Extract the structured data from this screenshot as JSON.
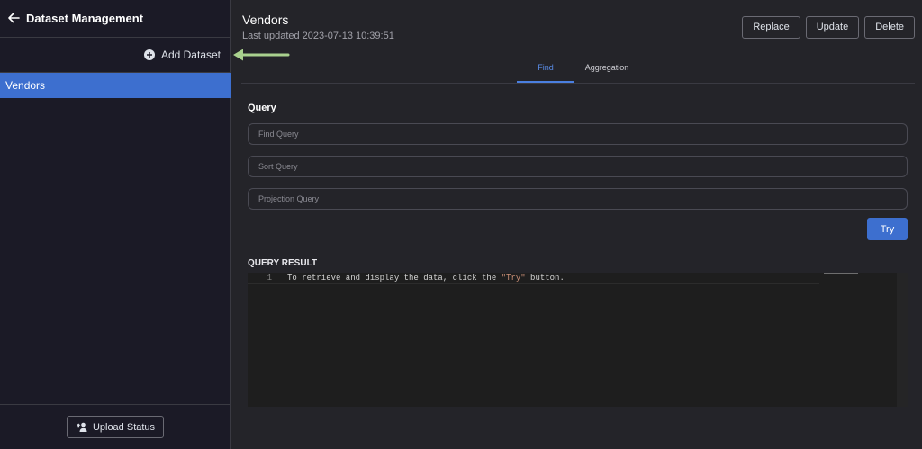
{
  "sidebar": {
    "title": "Dataset Management",
    "add_dataset_label": "Add Dataset",
    "datasets": [
      {
        "label": "Vendors",
        "selected": true
      }
    ],
    "upload_status_label": "Upload Status"
  },
  "main": {
    "title": "Vendors",
    "last_updated": "Last updated 2023-07-13 10:39:51",
    "actions": {
      "replace": "Replace",
      "update": "Update",
      "delete": "Delete"
    },
    "tabs": [
      {
        "label": "Find",
        "active": true
      },
      {
        "label": "Aggregation",
        "active": false
      }
    ],
    "query": {
      "label": "Query",
      "find_placeholder": "Find Query",
      "sort_placeholder": "Sort Query",
      "projection_placeholder": "Projection Query",
      "try_label": "Try"
    },
    "result": {
      "label": "QUERY RESULT",
      "line_number": "1",
      "line_before": "To retrieve and display the data, click the ",
      "line_string": "\"Try\"",
      "line_after": " button."
    }
  },
  "colors": {
    "accent": "#3d6fcf",
    "sidebar_bg": "#1b1a26",
    "main_bg": "#242429",
    "annotation_arrow": "#a9d18e"
  },
  "icons": [
    "back-arrow-icon",
    "plus-circle-icon",
    "upload-people-icon"
  ]
}
